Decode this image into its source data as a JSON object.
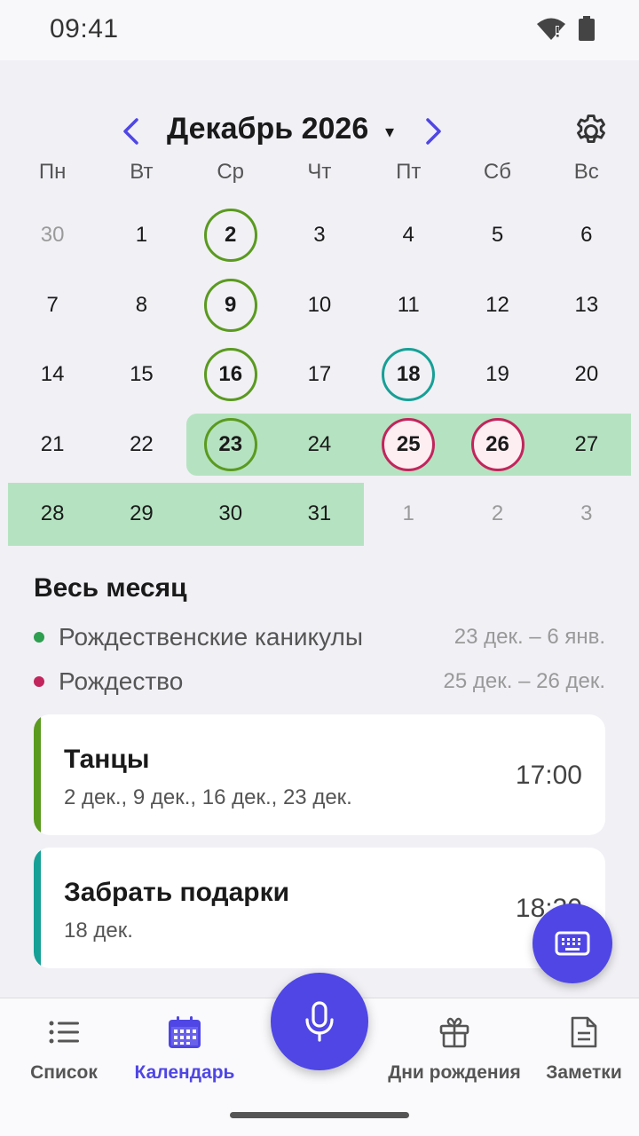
{
  "status_bar": {
    "time": "09:41",
    "icons": [
      "wifi-alert-icon",
      "battery-icon"
    ]
  },
  "calendar": {
    "month_title": "Декабрь 2026",
    "caret": "▾",
    "weekdays": [
      "Пн",
      "Вт",
      "Ср",
      "Чт",
      "Пт",
      "Сб",
      "Вс"
    ],
    "weeks": [
      [
        "30",
        "1",
        "2",
        "3",
        "4",
        "5",
        "6"
      ],
      [
        "7",
        "8",
        "9",
        "10",
        "11",
        "12",
        "13"
      ],
      [
        "14",
        "15",
        "16",
        "17",
        "18",
        "19",
        "20"
      ],
      [
        "21",
        "22",
        "23",
        "24",
        "25",
        "26",
        "27"
      ],
      [
        "28",
        "29",
        "30",
        "31",
        "1",
        "2",
        "3"
      ]
    ]
  },
  "month_section": {
    "title": "Весь месяц",
    "ranges": [
      {
        "name": "Рождественские каникулы",
        "dates": "23 дек. – 6 янв.",
        "color": "#2E9E4F"
      },
      {
        "name": "Рождество",
        "dates": "25 дек. – 26 дек.",
        "color": "#C2255C"
      }
    ]
  },
  "events": [
    {
      "title": "Танцы",
      "subtitle": "2 дек., 9 дек., 16 дек., 23 дек.",
      "time": "17:00",
      "color": "#5A9A1F"
    },
    {
      "title": "Забрать подарки",
      "subtitle": "18 дек.",
      "time": "18:30",
      "color": "#16A096"
    }
  ],
  "bottom_nav": {
    "items": [
      {
        "label": "Список",
        "icon": "list-icon"
      },
      {
        "label": "Календарь",
        "icon": "calendar-icon"
      },
      {
        "label": "Дни рождения",
        "icon": "gift-icon"
      },
      {
        "label": "Заметки",
        "icon": "note-icon"
      }
    ],
    "active": "Календарь"
  },
  "colors": {
    "accent": "#4F46E5",
    "band": "#B5E3C1",
    "green": "#5A9A1F",
    "teal": "#16A096",
    "pink": "#C2255C"
  }
}
